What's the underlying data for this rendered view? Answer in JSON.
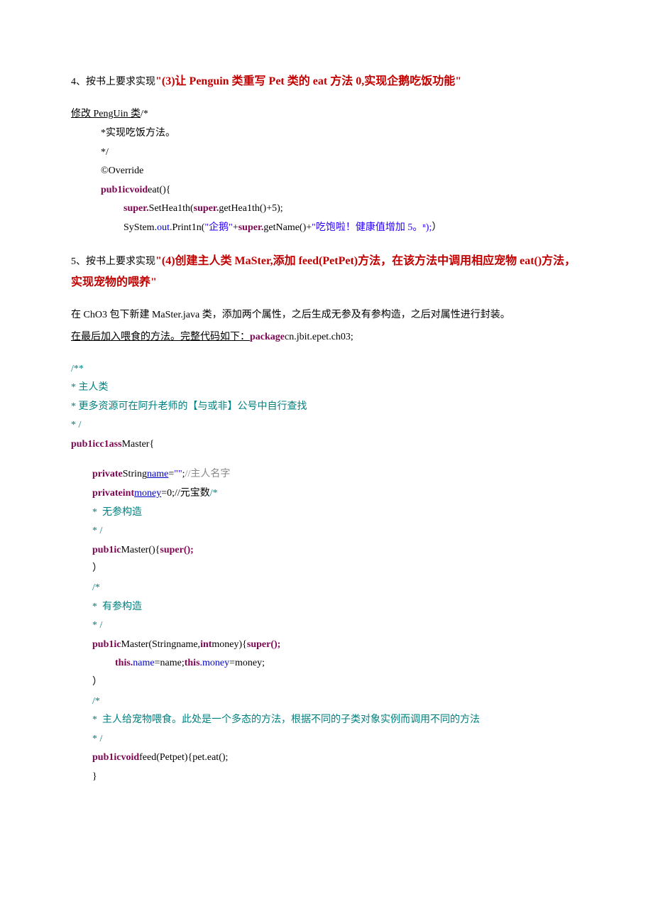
{
  "section4": {
    "prefix": "4、按书上要求实现",
    "title": "\"(3)让 Penguin 类重写 Pet 类的 eat 方法 0,实现企鹅吃饭功能\""
  },
  "block1": {
    "line1_a": "修改 PengUin 类",
    "line1_b": "/*",
    "line2": "*实现吃饭方法。",
    "line3": "*/",
    "line4": "©Override",
    "line5_kw": "pub1icvoid",
    "line5_rest": "eat(){",
    "line6_kw1": "super.",
    "line6_m": "SetHea1th",
    "line6_lp": "(",
    "line6_kw2": "super.",
    "line6_rest": "getHea1th()+5);",
    "line7_a": "SyStem.",
    "line7_out": "out",
    "line7_b": ".Print1n",
    "line7_lp": "(",
    "line7_str1": "\"企鹅\"",
    "line7_plus": "+",
    "line7_kw": "super.",
    "line7_c": "getName()+",
    "line7_str2": "\"吃饱啦！健康值增加 5。ⁿ);",
    "line7_end": "）"
  },
  "section5": {
    "prefix": "5、按书上要求实现",
    "title": "\"(4)创建主人类 MaSter,添加 feed(PetPet)方法，在该方法中调用相应宠物 eat()方法，实现宠物的喂养\""
  },
  "para2": {
    "p1": "在 ChO3 包下新建 MaSter.java 类，添加两个属性，之后生成无参及有参构造，之后对属性进行封装。",
    "p2a": "在最后加入喂食的方法。完整代码如下：",
    "p2kw": "package",
    "p2b": "cn.jbit.epet.ch03;"
  },
  "block2": {
    "l1": "/**",
    "l2": "*  主人类",
    "l3": "*  更多资源可在阿升老师的【与或非】公号中自行查找",
    "l4": "* /",
    "l5_kw": "pub1icc1ass",
    "l5_rest": "Master{",
    "l7_kw": "private",
    "l7_a": "String",
    "l7_name": "name",
    "l7_eq": "=",
    "l7_str": "\"\"",
    "l7_semi": ";",
    "l7_c": "//主人名字",
    "l8_kw": "privateint",
    "l8_name": "money",
    "l8_rest": "=0;//元宝数",
    "l8_c": "/*",
    "l9": "*  无参构造",
    "l10": "* /",
    "l11_kw": "pub1ic",
    "l11_a": "Master(){",
    "l11_kw2": "super();",
    "l12": "）",
    "l13": "/*",
    "l14": "*  有参构造",
    "l15": "* /",
    "l16_kw": "pub1ic",
    "l16_a": "Master(Stringname,",
    "l16_kw2": "int",
    "l16_b": "money){",
    "l16_kw3": "super();",
    "l17_kw1": "this.",
    "l17_a": "name",
    "l17_b": "=name;",
    "l17_kw2": "this",
    "l17_c": ".money",
    "l17_d": "=money;",
    "l18": "）",
    "l19": "/*",
    "l20": "*  主人给宠物喂食。此处是一个多态的方法，根据不同的子类对象实例而调用不同的方法",
    "l21": "* /",
    "l22_kw": "pub1icvoid",
    "l22_a": "feed(Petpet){pet.eat();",
    "l23": "}"
  }
}
